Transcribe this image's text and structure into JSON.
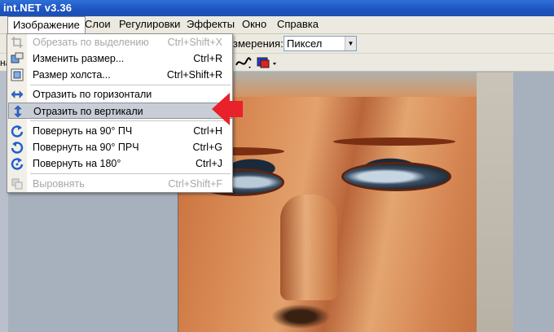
{
  "window": {
    "title": "int.NET v3.36"
  },
  "menubar": {
    "items": [
      {
        "label": "Изображение",
        "active": true
      },
      {
        "label": "Слои"
      },
      {
        "label": "Регулировки"
      },
      {
        "label": "Эффекты"
      },
      {
        "label": "Окно"
      },
      {
        "label": "Справка"
      }
    ]
  },
  "toolbar": {
    "units_label": "змерения:",
    "units_value": "Пиксел",
    "left_label": "на"
  },
  "image_menu": {
    "items": [
      {
        "label": "Обрезать по выделению",
        "shortcut": "Ctrl+Shift+X",
        "icon": "crop-icon",
        "disabled": true
      },
      {
        "label": "Изменить размер...",
        "shortcut": "Ctrl+R",
        "icon": "resize-icon"
      },
      {
        "label": "Размер холста...",
        "shortcut": "Ctrl+Shift+R",
        "icon": "canvas-size-icon"
      },
      {
        "label": "Отразить по горизонтали",
        "shortcut": "",
        "icon": "flip-horizontal-icon"
      },
      {
        "label": "Отразить по вертикали",
        "shortcut": "",
        "icon": "flip-vertical-icon",
        "highlighted": true
      },
      {
        "label": "Повернуть на 90° ПЧ",
        "shortcut": "Ctrl+H",
        "icon": "rotate-cw-icon"
      },
      {
        "label": "Повернуть на 90° ПРЧ",
        "shortcut": "Ctrl+G",
        "icon": "rotate-ccw-icon"
      },
      {
        "label": "Повернуть на 180°",
        "shortcut": "Ctrl+J",
        "icon": "rotate-180-icon"
      },
      {
        "label": "Выровнять",
        "shortcut": "Ctrl+Shift+F",
        "icon": "flatten-icon",
        "disabled": true
      }
    ]
  },
  "colors": {
    "title_bar": "#1b54c0",
    "menu_highlight": "#c9cdd6",
    "annotation_arrow": "#e8212a",
    "rotate_icon": "#1e5fd0"
  }
}
